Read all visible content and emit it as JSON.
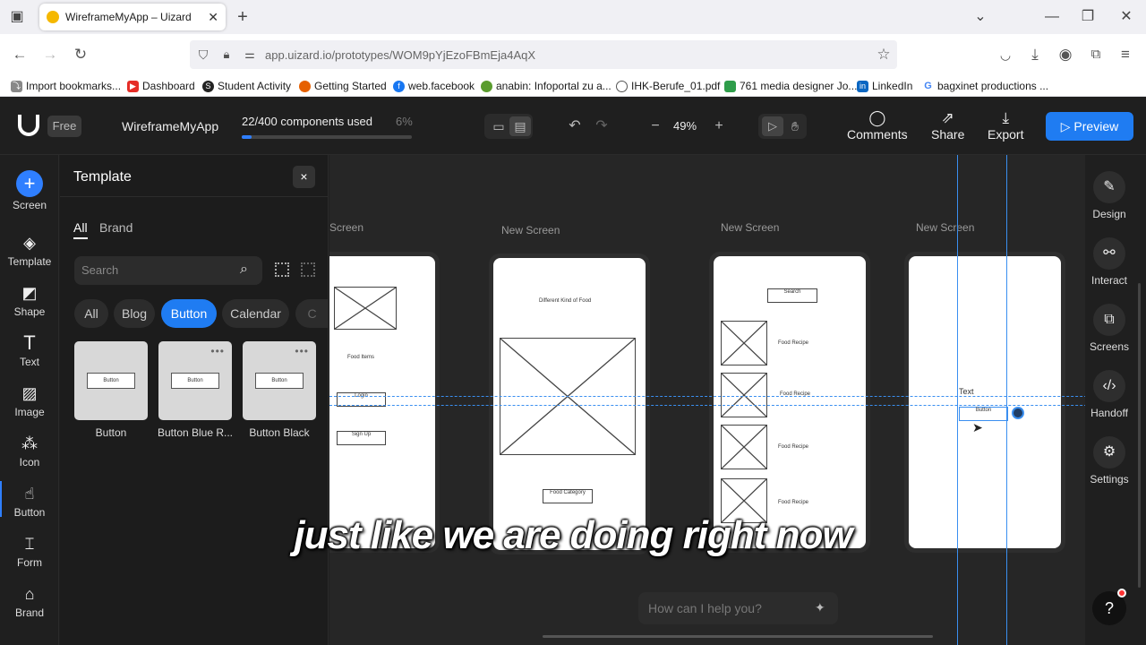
{
  "browser": {
    "tab_title": "WireframeMyApp – Uizard",
    "new_tab": "+",
    "url": "app.uizard.io/prototypes/WOM9pYjEzoFBmEja4AqX",
    "bookmarks": [
      {
        "label": "Import bookmarks...",
        "color": "#666666",
        "icon": "import-icon"
      },
      {
        "label": "Dashboard",
        "color": "#e52d27",
        "icon": "youtube-icon"
      },
      {
        "label": "Student Activity",
        "color": "#222222",
        "icon": "sk-icon"
      },
      {
        "label": "Getting Started",
        "color": "#e66000",
        "icon": "firefox-icon"
      },
      {
        "label": "web.facebook",
        "color": "#1877f2",
        "icon": "facebook-icon"
      },
      {
        "label": "anabin: Infoportal zu a...",
        "color": "#5a9c2e",
        "icon": "anabin-icon"
      },
      {
        "label": "IHK-Berufe_01.pdf",
        "color": "#555555",
        "icon": "globe-icon"
      },
      {
        "label": "761 media designer Jo...",
        "color": "#2e9d4a",
        "icon": "flag-icon"
      },
      {
        "label": "LinkedIn",
        "color": "#0a66c2",
        "icon": "linkedin-icon"
      },
      {
        "label": "bagxinet productions ...",
        "color": "#4285f4",
        "icon": "google-icon"
      }
    ]
  },
  "header": {
    "plan": "Free",
    "project": "WireframeMyApp",
    "usage_text": "22/400 components used",
    "usage_pct": "6%",
    "usage_fraction": 0.06,
    "zoom": "49%",
    "zoom_minus": "−",
    "zoom_plus": "+",
    "comments": "Comments",
    "share": "Share",
    "export": "Export",
    "preview": "Preview",
    "accent": "#1f7cf2"
  },
  "left_rail": [
    {
      "label": "Screen",
      "icon": "plus-icon"
    },
    {
      "label": "Template",
      "icon": "layers-icon"
    },
    {
      "label": "Shape",
      "icon": "shape-icon"
    },
    {
      "label": "Text",
      "icon": "text-icon"
    },
    {
      "label": "Image",
      "icon": "image-icon"
    },
    {
      "label": "Icon",
      "icon": "icon-icon"
    },
    {
      "label": "Button",
      "icon": "button-icon"
    },
    {
      "label": "Form",
      "icon": "form-icon"
    },
    {
      "label": "Brand",
      "icon": "brand-icon"
    }
  ],
  "panel": {
    "title": "Template",
    "close": "×",
    "tabs": [
      "All",
      "Brand"
    ],
    "search_placeholder": "Search",
    "chips": [
      "All",
      "Blog",
      "Button",
      "Calendar",
      "C"
    ],
    "active_chip": "Button",
    "cards": [
      {
        "label": "Button",
        "mini": "Button"
      },
      {
        "label": "Button Blue R...",
        "mini": "Button"
      },
      {
        "label": "Button Black",
        "mini": "Button"
      }
    ]
  },
  "canvas": {
    "screens": [
      {
        "label": "Screen",
        "texts": [
          "Food Items",
          "Login",
          "Sign Up"
        ]
      },
      {
        "label": "New Screen",
        "texts": [
          "Different Kind of Food",
          "Food Category"
        ]
      },
      {
        "label": "New Screen",
        "texts": [
          "Search",
          "Food Recipe",
          "Food Recipe",
          "Food Recipe",
          "Food Recipe"
        ]
      },
      {
        "label": "New Screen",
        "texts": [
          "Text",
          "Button"
        ]
      }
    ],
    "subtitle": "just like we are doing right now",
    "help_placeholder": "How can I help you?"
  },
  "right_rail": [
    {
      "label": "Design",
      "icon": "pen-icon"
    },
    {
      "label": "Interact",
      "icon": "link-icon"
    },
    {
      "label": "Screens",
      "icon": "screens-icon"
    },
    {
      "label": "Handoff",
      "icon": "code-icon"
    },
    {
      "label": "Settings",
      "icon": "gear-icon"
    }
  ],
  "help_button": "?"
}
